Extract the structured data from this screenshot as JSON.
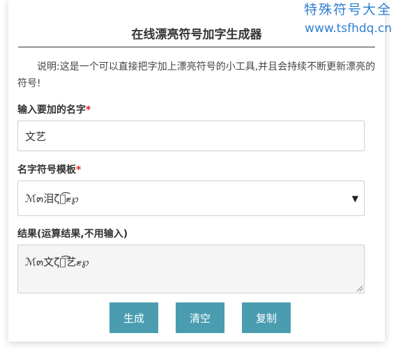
{
  "watermark": {
    "name": "特殊符号大全",
    "url": "www.tsfhdq.cn"
  },
  "title": "在线漂亮符号加字生成器",
  "description": "说明:这是一个可以直接把字加上漂亮符号的小工具,并且会持续不断更新漂亮的符号!",
  "name_field": {
    "label": "输入要加的名字",
    "required_mark": "*",
    "value": "文艺"
  },
  "template_field": {
    "label": "名字符号模板",
    "required_mark": "*",
    "selected": "ℳ๓泪ζั͡ޓ℘",
    "arrow": "▼"
  },
  "result_field": {
    "label": "结果(运算结果,不用输入)",
    "value": "ℳ๓文ζั͡艺ޓ℘"
  },
  "buttons": {
    "generate": "生成",
    "clear": "清空",
    "copy": "复制"
  },
  "colors": {
    "button": "#4a9db0",
    "required": "#e02020",
    "watermark": "#2f7fd1"
  }
}
